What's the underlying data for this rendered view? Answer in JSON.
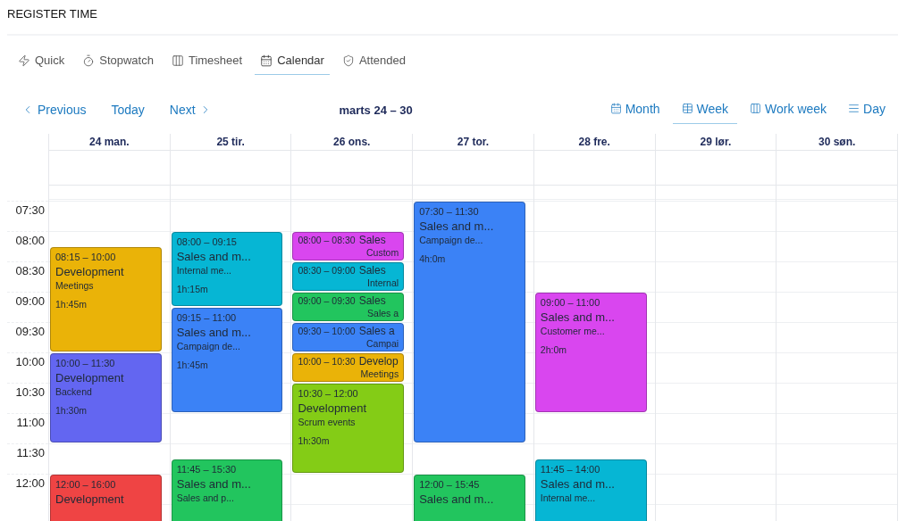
{
  "page_title": "REGISTER TIME",
  "tabs": [
    {
      "label": "Quick",
      "selected": false
    },
    {
      "label": "Stopwatch",
      "selected": false
    },
    {
      "label": "Timesheet",
      "selected": false
    },
    {
      "label": "Calendar",
      "selected": true
    },
    {
      "label": "Attended",
      "selected": false
    }
  ],
  "nav": {
    "previous": "Previous",
    "today": "Today",
    "next": "Next",
    "range": "marts 24 – 30"
  },
  "views": [
    {
      "label": "Month",
      "selected": false
    },
    {
      "label": "Week",
      "selected": true
    },
    {
      "label": "Work week",
      "selected": false
    },
    {
      "label": "Day",
      "selected": false
    }
  ],
  "times": [
    "07:30",
    "08:00",
    "08:30",
    "09:00",
    "09:30",
    "10:00",
    "10:30",
    "11:00",
    "11:30",
    "12:00"
  ],
  "days": [
    {
      "label": "24 man.",
      "events": [
        {
          "kind": "full",
          "time": "08:15 – 10:00",
          "title": "Development",
          "subtitle": "Meetings",
          "duration": "1h:45m",
          "color": "#eab308"
        },
        {
          "kind": "full",
          "time": "10:00 – 11:30",
          "title": "Development",
          "subtitle": "Backend",
          "duration": "1h:30m",
          "color": "#6366f1"
        },
        {
          "kind": "full",
          "time": "12:00 – 16:00",
          "title": "Development",
          "color": "#ef4444"
        }
      ]
    },
    {
      "label": "25 tir.",
      "events": [
        {
          "kind": "full",
          "time": "08:00 – 09:15",
          "title": "Sales and m...",
          "subtitle": "Internal me...",
          "duration": "1h:15m",
          "color": "#06b6d4"
        },
        {
          "kind": "full",
          "time": "09:15 – 11:00",
          "title": "Sales and m...",
          "subtitle": "Campaign de...",
          "duration": "1h:45m",
          "color": "#3b82f6"
        },
        {
          "kind": "full",
          "time": "11:45 – 15:30",
          "title": "Sales and m...",
          "subtitle": "Sales and p...",
          "color": "#22c55e"
        }
      ]
    },
    {
      "label": "26 ons.",
      "events": [
        {
          "kind": "compact",
          "time": "08:00 – 08:30",
          "title": "Sales",
          "subtitle": "Custom",
          "color": "#d946ef"
        },
        {
          "kind": "compact",
          "time": "08:30 – 09:00",
          "title": "Sales",
          "subtitle": "Internal",
          "color": "#06b6d4"
        },
        {
          "kind": "compact",
          "time": "09:00 – 09:30",
          "title": "Sales",
          "subtitle": "Sales a",
          "color": "#22c55e"
        },
        {
          "kind": "compact",
          "time": "09:30 – 10:00",
          "title": "Sales a",
          "subtitle": "Campai",
          "color": "#3b82f6"
        },
        {
          "kind": "compact",
          "time": "10:00 – 10:30",
          "title": "Develop",
          "subtitle": "Meetings",
          "color": "#eab308"
        },
        {
          "kind": "full",
          "time": "10:30 – 12:00",
          "title": "Development",
          "subtitle": "Scrum events",
          "duration": "1h:30m",
          "color": "#84cc16"
        }
      ]
    },
    {
      "label": "27 tor.",
      "events": [
        {
          "kind": "full",
          "time": "07:30 – 11:30",
          "title": "Sales and m...",
          "subtitle": "Campaign de...",
          "duration": "4h:0m",
          "color": "#3b82f6"
        },
        {
          "kind": "full",
          "time": "12:00 – 15:45",
          "title": "Sales and m...",
          "color": "#22c55e"
        }
      ]
    },
    {
      "label": "28 fre.",
      "events": [
        {
          "kind": "full",
          "time": "09:00 – 11:00",
          "title": "Sales and m...",
          "subtitle": "Customer me...",
          "duration": "2h:0m",
          "color": "#d946ef"
        },
        {
          "kind": "full",
          "time": "11:45 – 14:00",
          "title": "Sales and m...",
          "subtitle": "Internal me...",
          "color": "#06b6d4"
        }
      ]
    },
    {
      "label": "29 lør."
    },
    {
      "label": "30 søn."
    }
  ]
}
